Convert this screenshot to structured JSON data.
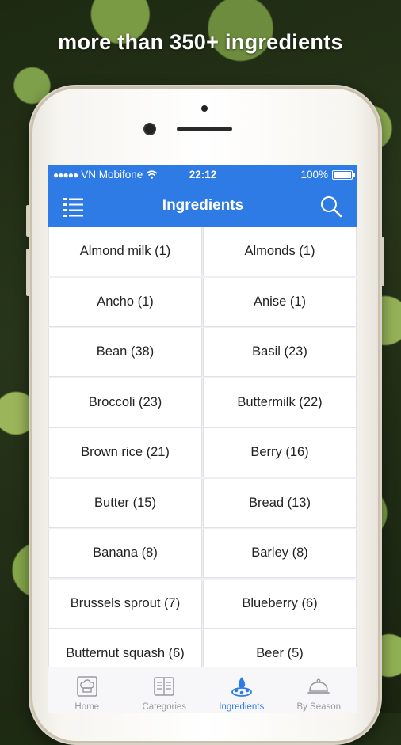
{
  "promo": {
    "headline": "more than 350+ ingredients"
  },
  "status_bar": {
    "carrier": "VN Mobifone",
    "time": "22:12",
    "battery": "100%"
  },
  "nav": {
    "title": "Ingredients",
    "menu_icon": "list-menu-icon",
    "search_icon": "search-icon"
  },
  "ingredients": [
    {
      "label": "Almond milk (1)"
    },
    {
      "label": "Almonds (1)"
    },
    {
      "label": "Ancho (1)"
    },
    {
      "label": "Anise (1)"
    },
    {
      "label": "Bean (38)"
    },
    {
      "label": "Basil (23)"
    },
    {
      "label": "Broccoli (23)"
    },
    {
      "label": "Buttermilk (22)"
    },
    {
      "label": "Brown rice (21)"
    },
    {
      "label": "Berry (16)"
    },
    {
      "label": "Butter (15)"
    },
    {
      "label": "Bread (13)"
    },
    {
      "label": "Banana (8)"
    },
    {
      "label": "Barley (8)"
    },
    {
      "label": "Brussels sprout (7)"
    },
    {
      "label": "Blueberry (6)"
    },
    {
      "label": "Butternut squash (6)"
    },
    {
      "label": "Beer (5)"
    }
  ],
  "tabs": [
    {
      "label": "Home",
      "icon": "chef-hat-icon",
      "active": false
    },
    {
      "label": "Categories",
      "icon": "categories-icon",
      "active": false
    },
    {
      "label": "Ingredients",
      "icon": "ingredients-icon",
      "active": true
    },
    {
      "label": "By Season",
      "icon": "cloche-icon",
      "active": false
    }
  ],
  "colors": {
    "accent": "#2f7be6",
    "tab_inactive": "#9a9a9f"
  }
}
